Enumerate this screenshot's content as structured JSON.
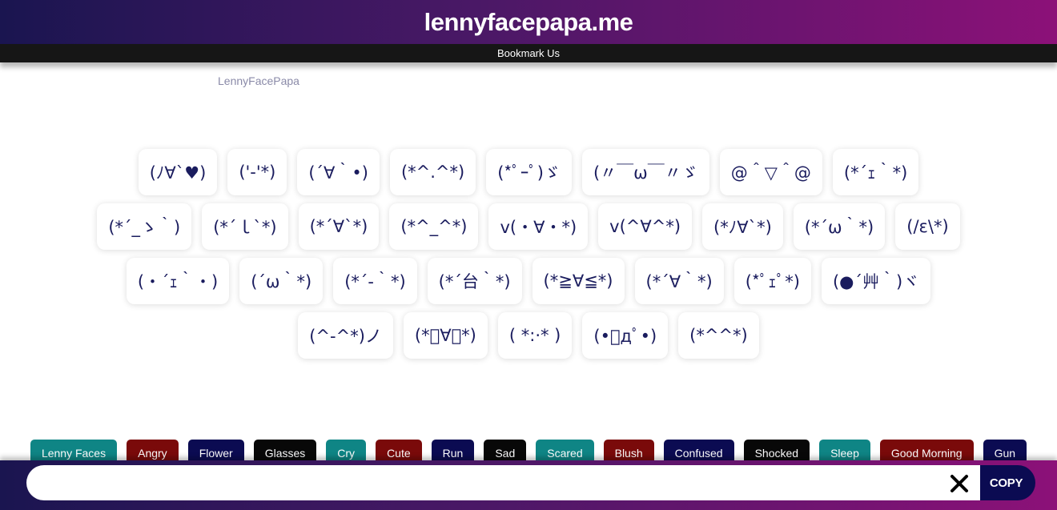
{
  "header": {
    "title": "lennyfacepapa.me",
    "bookmark_label": "Bookmark Us"
  },
  "breadcrumb": "LennyFacePapa",
  "faces": [
    [
      "(ﾉ∀`♥)",
      "('-'*)",
      "(´∀｀•)",
      "(*^.^*)",
      "(*ﾟｰﾟ)ゞ",
      "(〃￣ω￣〃ゞ",
      "@＾▽＾@",
      "(*´ｪ｀*)"
    ],
    [
      "(*´_ゝ｀)",
      "(*´ｌ`*)",
      "(*´∀`*)",
      "(*^_^*)",
      "v(・∀・*)",
      "v(^∀^*)",
      "(*ﾉ∀`*)",
      "(*´ω｀*)",
      "(/ε\\*)"
    ],
    [
      "(・´ｪ｀・)",
      "(´ω｀*)",
      "(*´-｀*)",
      "(*´台｀*)",
      "(*≧∀≦*)",
      "(*´∀｀*)",
      "(*ﾟｪﾟ*)",
      "(●´艸｀)ヾ"
    ],
    [
      "(^-^*)ノ",
      "(*ﾟ∀ﾟ*)",
      "( *:·* )",
      "(•ﾟдﾟ•)",
      "(*^^*)"
    ]
  ],
  "categories": [
    {
      "label": "Lenny Faces",
      "color": "#0f8585"
    },
    {
      "label": "Angry",
      "color": "#7a0a0a"
    },
    {
      "label": "Flower",
      "color": "#0b0b52"
    },
    {
      "label": "Glasses",
      "color": "#080808"
    },
    {
      "label": "Cry",
      "color": "#0f8585"
    },
    {
      "label": "Cute",
      "color": "#7a0a0a"
    },
    {
      "label": "Run",
      "color": "#0b0b52"
    },
    {
      "label": "Sad",
      "color": "#080808"
    },
    {
      "label": "Scared",
      "color": "#0f8585"
    },
    {
      "label": "Blush",
      "color": "#7a0a0a"
    },
    {
      "label": "Confused",
      "color": "#0b0b52"
    },
    {
      "label": "Shocked",
      "color": "#080808"
    },
    {
      "label": "Sleep",
      "color": "#0f8585"
    },
    {
      "label": "Good Morning",
      "color": "#7a0a0a"
    },
    {
      "label": "Gun",
      "color": "#0b0b52"
    }
  ],
  "copy_bar": {
    "input_value": "",
    "copy_label": "COPY",
    "clear_icon": "close-icon"
  }
}
